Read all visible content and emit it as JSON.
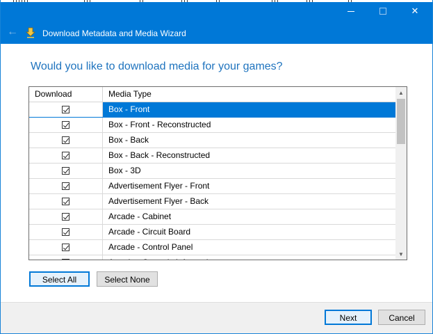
{
  "window": {
    "title": "Download Metadata and Media Wizard",
    "accent_color": "#0078d7",
    "icons": {
      "back": "back-arrow-icon",
      "app": "download-arrow-icon",
      "minimize": "minimize-icon",
      "maximize": "maximize-icon",
      "close": "close-icon"
    },
    "glyphs": {
      "back": "←",
      "close": "✕"
    }
  },
  "main": {
    "heading": "Would you like to download media for your games?",
    "heading_color": "#1e73be"
  },
  "grid": {
    "columns": [
      "Download",
      "Media Type"
    ],
    "rows": [
      {
        "name": "Box - Front",
        "checked": true,
        "selected": true
      },
      {
        "name": "Box - Front - Reconstructed",
        "checked": true,
        "selected": false
      },
      {
        "name": "Box - Back",
        "checked": true,
        "selected": false
      },
      {
        "name": "Box - Back - Reconstructed",
        "checked": true,
        "selected": false
      },
      {
        "name": "Box - 3D",
        "checked": true,
        "selected": false
      },
      {
        "name": "Advertisement Flyer - Front",
        "checked": true,
        "selected": false
      },
      {
        "name": "Advertisement Flyer - Back",
        "checked": true,
        "selected": false
      },
      {
        "name": "Arcade - Cabinet",
        "checked": true,
        "selected": false
      },
      {
        "name": "Arcade - Circuit Board",
        "checked": true,
        "selected": false
      },
      {
        "name": "Arcade - Control Panel",
        "checked": true,
        "selected": false
      },
      {
        "name": "Arcade - Controls Information",
        "checked": true,
        "selected": false
      }
    ],
    "scroll": {
      "up_glyph": "▲",
      "down_glyph": "▼",
      "position_fraction": 0.0,
      "visible_fraction": 0.3
    }
  },
  "buttons": {
    "select_all": "Select All",
    "select_none": "Select None",
    "next": "Next",
    "cancel": "Cancel"
  }
}
